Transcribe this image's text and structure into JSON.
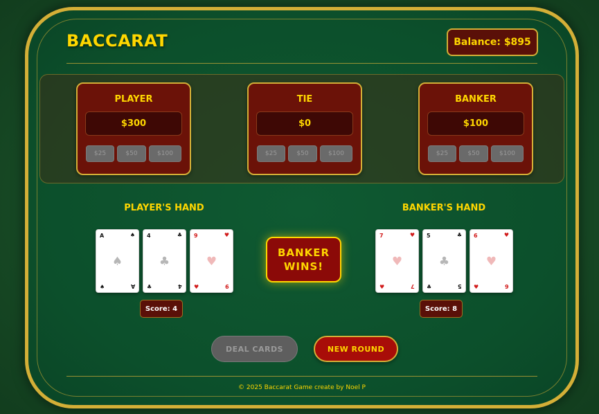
{
  "title": "BACCARAT",
  "balance": "Balance: $895",
  "bets": [
    {
      "label": "PLAYER",
      "amount": "$300",
      "chips": [
        "$25",
        "$50",
        "$100"
      ]
    },
    {
      "label": "TIE",
      "amount": "$0",
      "chips": [
        "$25",
        "$50",
        "$100"
      ]
    },
    {
      "label": "BANKER",
      "amount": "$100",
      "chips": [
        "$25",
        "$50",
        "$100"
      ]
    }
  ],
  "player_hand": {
    "title": "PLAYER'S HAND",
    "score": "Score: 4",
    "cards": [
      {
        "rank": "A",
        "suit": "♠",
        "color": "black"
      },
      {
        "rank": "4",
        "suit": "♣",
        "color": "black"
      },
      {
        "rank": "9",
        "suit": "♥",
        "color": "red"
      }
    ]
  },
  "banker_hand": {
    "title": "BANKER'S HAND",
    "score": "Score: 8",
    "cards": [
      {
        "rank": "7",
        "suit": "♥",
        "color": "red"
      },
      {
        "rank": "5",
        "suit": "♣",
        "color": "black"
      },
      {
        "rank": "6",
        "suit": "♥",
        "color": "red"
      }
    ]
  },
  "result": "BANKER WINS!",
  "buttons": {
    "deal": "DEAL CARDS",
    "new_round": "NEW ROUND"
  },
  "footer": "© 2025 Baccarat Game create by Noel P",
  "colors": {
    "gold": "#ffd700",
    "felt": "#0c4f2b",
    "panel": "#6b1208"
  }
}
